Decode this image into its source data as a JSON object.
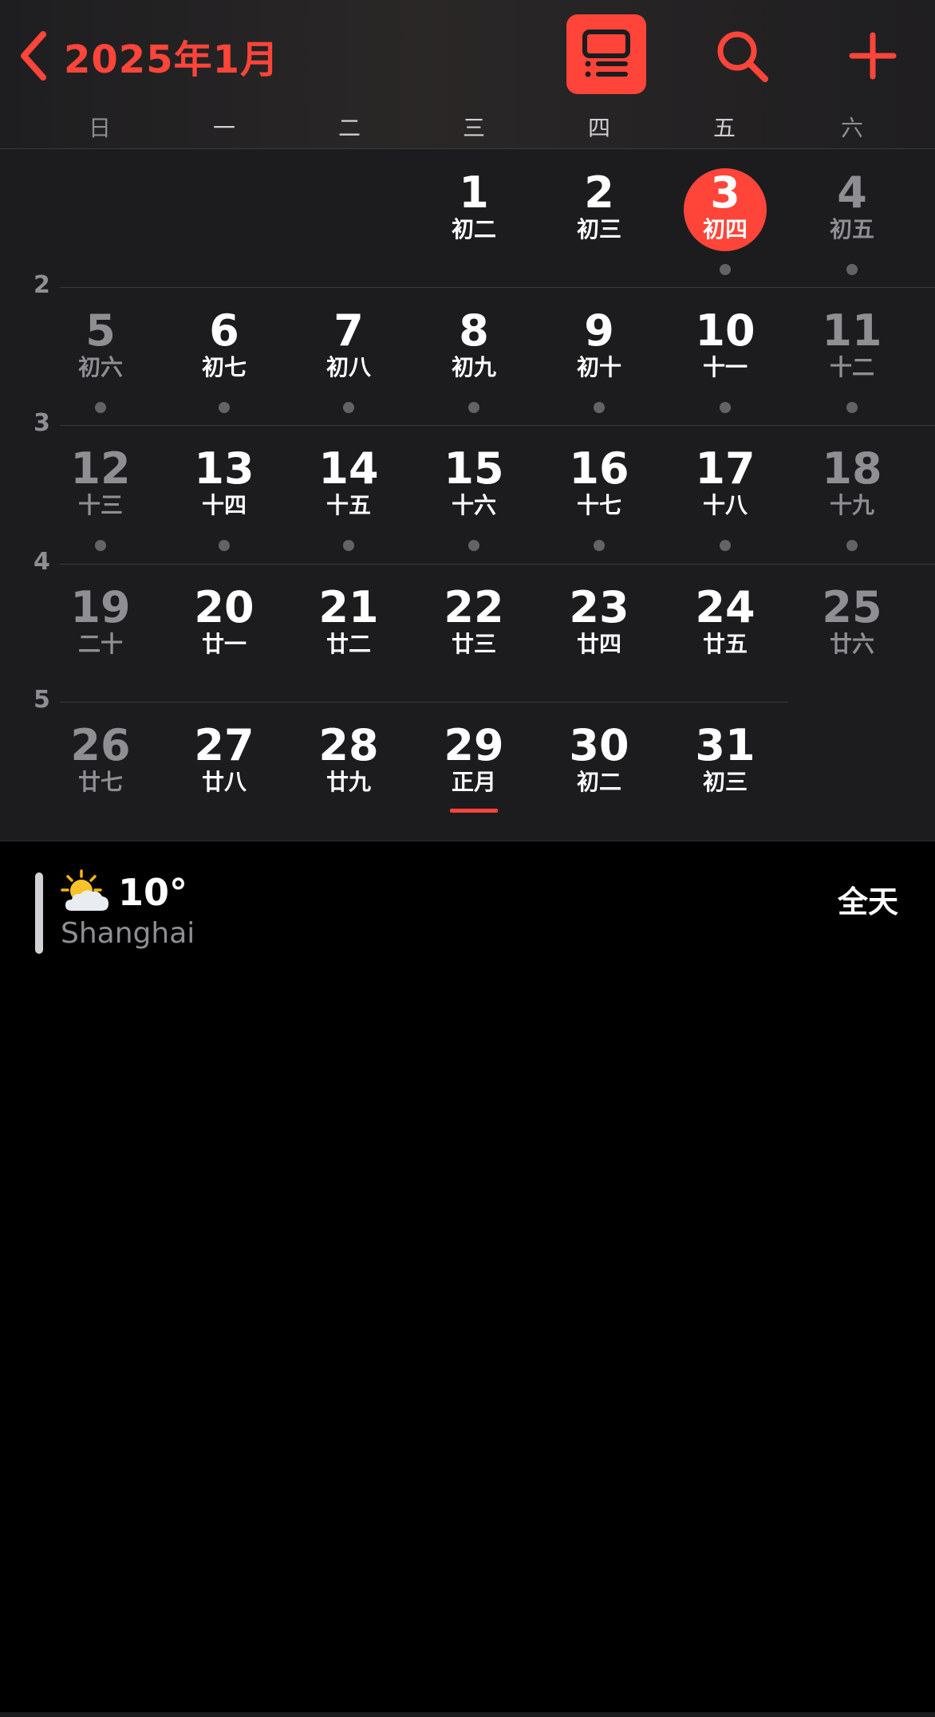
{
  "header": {
    "title": "2025年1月",
    "accent_color": "#ff453a",
    "icons": {
      "back": "chevron-left-icon",
      "view": "list-view-icon",
      "search": "search-icon",
      "add": "plus-icon"
    }
  },
  "weekdays": [
    "日",
    "一",
    "二",
    "三",
    "四",
    "五",
    "六"
  ],
  "week_numbers": [
    "2",
    "3",
    "4",
    "5"
  ],
  "days": [
    {
      "day": "1",
      "lunar": "初二"
    },
    {
      "day": "2",
      "lunar": "初三"
    },
    {
      "day": "3",
      "lunar": "初四",
      "today": true,
      "event": true
    },
    {
      "day": "4",
      "lunar": "初五",
      "event": true
    },
    {
      "day": "5",
      "lunar": "初六",
      "event": true
    },
    {
      "day": "6",
      "lunar": "初七",
      "event": true
    },
    {
      "day": "7",
      "lunar": "初八",
      "event": true
    },
    {
      "day": "8",
      "lunar": "初九",
      "event": true
    },
    {
      "day": "9",
      "lunar": "初十",
      "event": true
    },
    {
      "day": "10",
      "lunar": "十一",
      "event": true
    },
    {
      "day": "11",
      "lunar": "十二",
      "event": true
    },
    {
      "day": "12",
      "lunar": "十三",
      "event": true
    },
    {
      "day": "13",
      "lunar": "十四",
      "event": true
    },
    {
      "day": "14",
      "lunar": "十五",
      "event": true
    },
    {
      "day": "15",
      "lunar": "十六",
      "event": true
    },
    {
      "day": "16",
      "lunar": "十七",
      "event": true
    },
    {
      "day": "17",
      "lunar": "十八",
      "event": true
    },
    {
      "day": "18",
      "lunar": "十九",
      "event": true
    },
    {
      "day": "19",
      "lunar": "二十"
    },
    {
      "day": "20",
      "lunar": "廿一"
    },
    {
      "day": "21",
      "lunar": "廿二"
    },
    {
      "day": "22",
      "lunar": "廿三"
    },
    {
      "day": "23",
      "lunar": "廿四"
    },
    {
      "day": "24",
      "lunar": "廿五"
    },
    {
      "day": "25",
      "lunar": "廿六"
    },
    {
      "day": "26",
      "lunar": "廿七"
    },
    {
      "day": "27",
      "lunar": "廿八"
    },
    {
      "day": "28",
      "lunar": "廿九"
    },
    {
      "day": "29",
      "lunar": "正月",
      "festival_mark": true
    },
    {
      "day": "30",
      "lunar": "初二"
    },
    {
      "day": "31",
      "lunar": "初三"
    }
  ],
  "event": {
    "weather_icon": "sun-behind-cloud-icon",
    "temperature": "10°",
    "city": "Shanghai",
    "all_day_label": "全天"
  }
}
